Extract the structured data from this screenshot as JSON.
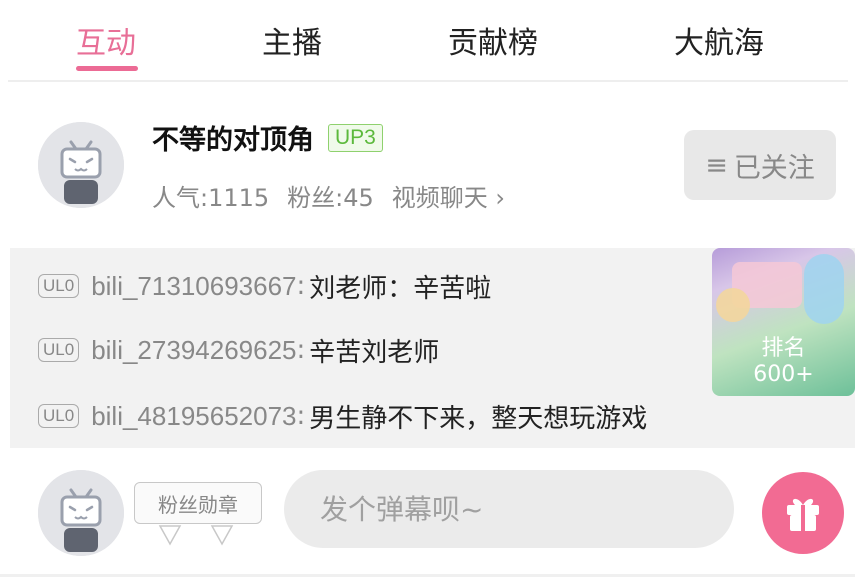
{
  "tabs": [
    {
      "label": "互动",
      "active": true
    },
    {
      "label": "主播",
      "active": false
    },
    {
      "label": "贡献榜",
      "active": false
    },
    {
      "label": "大航海",
      "active": false
    }
  ],
  "anchor": {
    "name": "不等的对顶角",
    "up_level": "UP3",
    "popularity": "人气:1115",
    "fans": "粉丝:45",
    "video_chat": "视频聊天 ›",
    "follow_icon": "≡",
    "follow_label": "已关注"
  },
  "chat": [
    {
      "badge": "UL0",
      "user": "bili_71310693667",
      "message": "刘老师：辛苦啦"
    },
    {
      "badge": "UL0",
      "user": "bili_27394269625",
      "message": "辛苦刘老师"
    },
    {
      "badge": "UL0",
      "user": "bili_48195652073",
      "message": "男生静不下来，整天想玩游戏"
    }
  ],
  "rank_card": {
    "label": "排名",
    "value": "600+"
  },
  "bottom": {
    "medal_label": "粉丝勋章",
    "input_placeholder": "发个弹幕呗~"
  },
  "colors": {
    "accent": "#ec6b95",
    "gift": "#f26b93",
    "up_badge": "#5cb93c"
  },
  "icons": {
    "avatar": "bilibili-tv-avatar-icon",
    "gift": "gift-box-icon",
    "follow": "list-menu-icon"
  }
}
